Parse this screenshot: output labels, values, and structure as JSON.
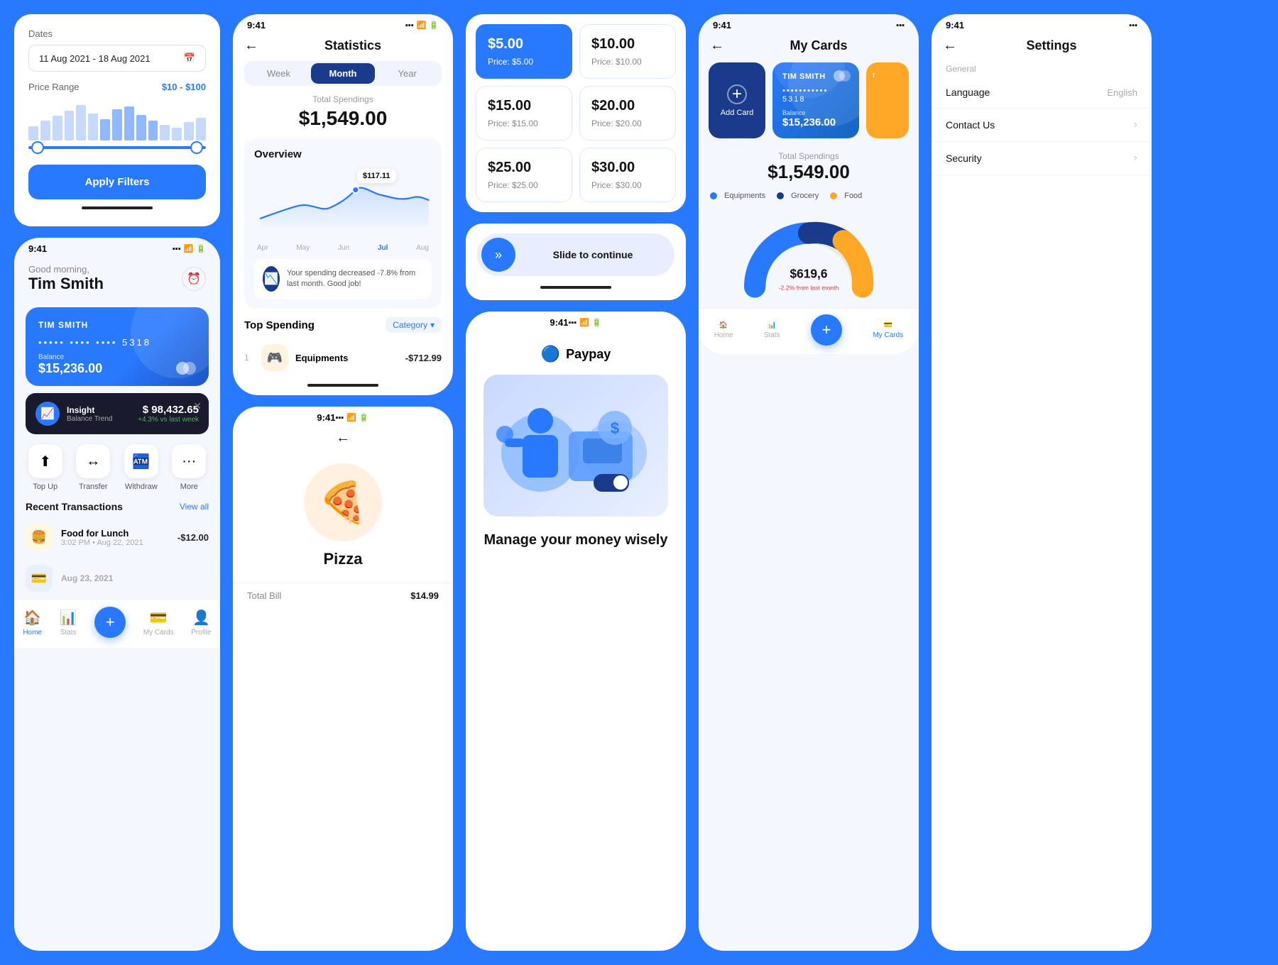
{
  "filter": {
    "title": "Dates",
    "date_value": "11 Aug 2021 - 18 Aug 2021",
    "price_range_label": "Price Range",
    "price_range_value": "$10 - $100",
    "apply_label": "Apply Filters",
    "histogram_heights": [
      20,
      28,
      35,
      42,
      50,
      38,
      30,
      44,
      48,
      36,
      28,
      22,
      18,
      26,
      32
    ]
  },
  "home": {
    "status_time": "9:41",
    "greeting": "Good morning,",
    "user_name": "Tim Smith",
    "card_holder": "TIM SMITH",
    "card_dots": "•••••  ••••  ••••",
    "card_number": "5318",
    "balance_label": "Balance",
    "balance": "$15,236.00",
    "insight_title": "Insight",
    "insight_subtitle": "Balance Trend",
    "insight_amount": "$ 98,432.65",
    "insight_change": "+4.3% vs last week",
    "actions": [
      {
        "label": "Top Up",
        "icon": "⬆"
      },
      {
        "label": "Transfer",
        "icon": "↔"
      },
      {
        "label": "Withdraw",
        "icon": "🏧"
      },
      {
        "label": "More",
        "icon": "···"
      }
    ],
    "recent_title": "Recent Transactions",
    "view_all": "View all",
    "transactions": [
      {
        "name": "Food for Lunch",
        "time": "3:02 PM • Aug 22, 2021",
        "amount": "-$12.00",
        "icon": "🍔"
      }
    ],
    "nav": [
      {
        "label": "Home",
        "icon": "🏠",
        "active": true
      },
      {
        "label": "Stats",
        "icon": "📊",
        "active": false
      },
      {
        "label": "My Cards",
        "icon": "💳",
        "active": false
      },
      {
        "label": "Profile",
        "icon": "👤",
        "active": false
      }
    ]
  },
  "statistics": {
    "status_time": "9:41",
    "title": "Statistics",
    "back": "←",
    "tabs": [
      "Week",
      "Month",
      "Year"
    ],
    "active_tab": "Month",
    "total_label": "Total Spendings",
    "total_amount": "$1,549.00",
    "overview_title": "Overview",
    "chart_tooltip": "$117.11",
    "chart_labels": [
      "Apr",
      "May",
      "Jun",
      "Jul",
      "Aug"
    ],
    "active_label": "Jul",
    "insight_text": "Your spending decreased -7.8% from last month. Good job!",
    "top_spending_title": "Top Spending",
    "category_btn": "Category",
    "spending_items": [
      {
        "rank": "1",
        "name": "Equipments",
        "amount": "-$712.99",
        "icon": "🎮"
      }
    ]
  },
  "pizza": {
    "status_time": "9:41",
    "back": "←",
    "icon": "🍕",
    "name": "Pizza",
    "bill_label": "Total Bill",
    "bill_value": "$14.99"
  },
  "topup": {
    "cards": [
      {
        "amount": "$5.00",
        "price": "Price: $5.00",
        "selected": true
      },
      {
        "amount": "$10.00",
        "price": "Price: $10.00",
        "selected": false
      },
      {
        "amount": "$15.00",
        "price": "Price: $15.00",
        "selected": false
      },
      {
        "amount": "$20.00",
        "price": "Price: $20.00",
        "selected": false
      },
      {
        "amount": "$25.00",
        "price": "Price: $25.00",
        "selected": false
      },
      {
        "amount": "$30.00",
        "price": "Price: $30.00",
        "selected": false
      }
    ],
    "slide_text": "Slide to continue"
  },
  "paypay": {
    "status_time": "9:41",
    "logo": "Paypay",
    "tagline": "Manage your money wisely"
  },
  "mycards": {
    "status_time": "9:41",
    "title": "My Cards",
    "back": "←",
    "add_card_label": "Add Card",
    "card_holder": "TIM SMITH",
    "card_dots": "•••••••••••",
    "card_number": "5318",
    "balance_label": "Balance",
    "balance": "$15,236.00",
    "total_label": "Total Spendings",
    "total_amount": "$1,549.00",
    "legend": [
      {
        "label": "Equipments",
        "color": "#2979FF"
      },
      {
        "label": "Grocery",
        "color": "#1a3a8c"
      },
      {
        "label": "Food",
        "color": "#FFA726"
      }
    ],
    "donut_amount": "$619,6",
    "donut_change": "-2.2% from last month",
    "nav": [
      {
        "label": "Home",
        "icon": "🏠"
      },
      {
        "label": "Stats",
        "icon": "📊"
      },
      {
        "label": "My Cards",
        "icon": "💳",
        "active": true
      },
      {
        "label": "",
        "icon": "+",
        "fab": true
      }
    ]
  },
  "settings": {
    "status_time": "9:41",
    "title": "Settings",
    "back": "←",
    "section_general": "General",
    "rows": [
      {
        "label": "Language",
        "value": "English"
      },
      {
        "label": "Contact Us",
        "value": ""
      },
      {
        "label": "Security",
        "value": ""
      }
    ]
  },
  "colors": {
    "primary": "#2979FF",
    "dark_card": "#1a3a8c",
    "orange": "#FFA726",
    "bg": "#2979FF"
  }
}
